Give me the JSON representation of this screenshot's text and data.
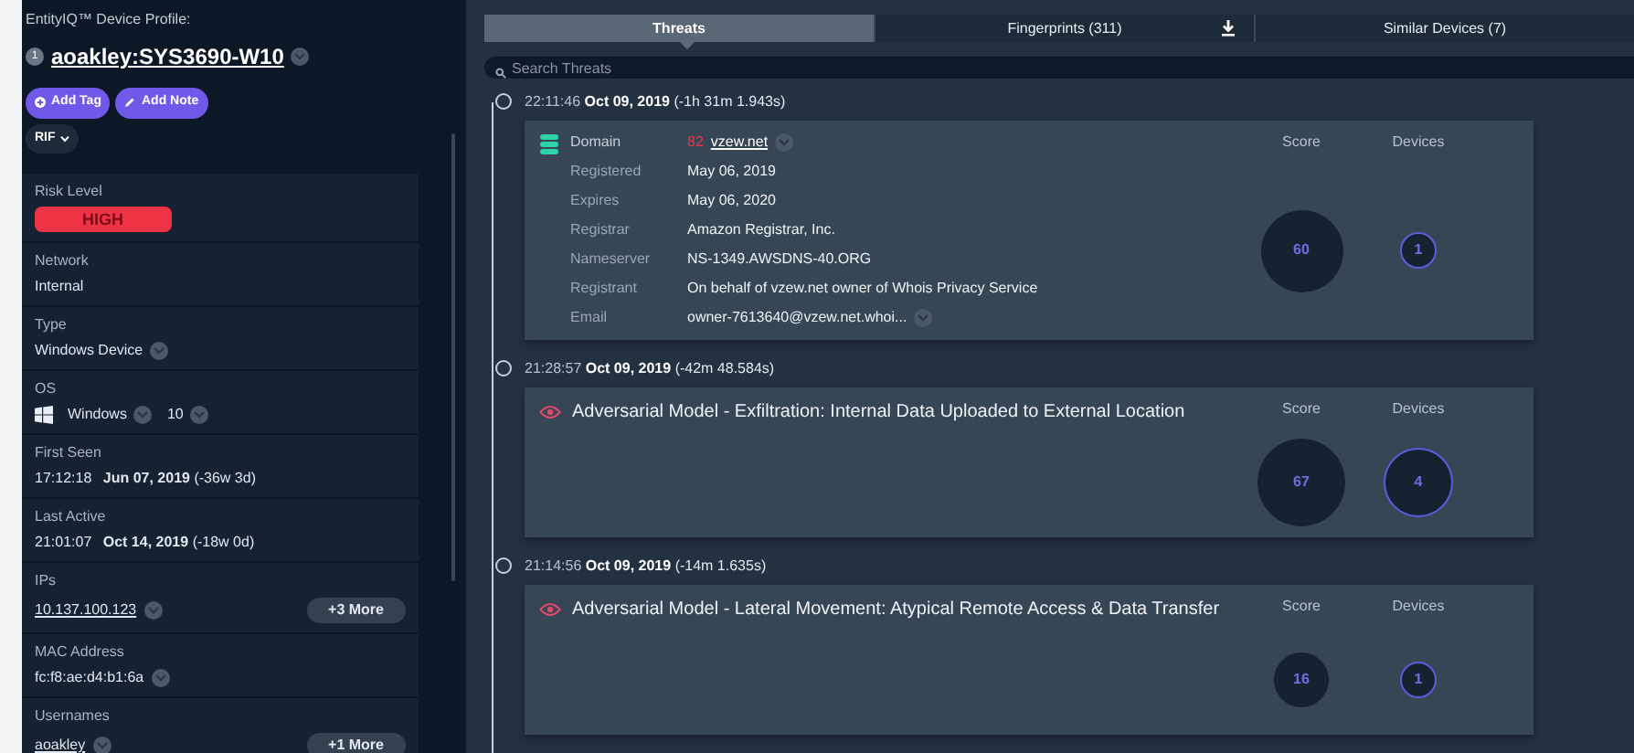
{
  "header": {
    "caption": "EntityIQ™ Device Profile:",
    "badge": "1",
    "device_name": "aoakley:SYS3690-W10"
  },
  "actions": [
    {
      "kind": "tag",
      "label": "Add Tag"
    },
    {
      "kind": "note",
      "label": "Add Note"
    }
  ],
  "rif": {
    "label": "RIF"
  },
  "fields": [
    {
      "kind": "risk",
      "label": "Risk Level",
      "value": "HIGH"
    },
    {
      "kind": "text",
      "label": "Network",
      "value": "Internal"
    },
    {
      "kind": "text",
      "label": "Type",
      "value": "Windows Device",
      "menu": true
    },
    {
      "kind": "os",
      "label": "OS",
      "value": "Windows",
      "version": "10"
    },
    {
      "kind": "time",
      "label": "First Seen",
      "time": "17:12:18",
      "date": "Jun 07, 2019",
      "ago": "(-36w 3d)"
    },
    {
      "kind": "time",
      "label": "Last Active",
      "time": "21:01:07",
      "date": "Oct 14, 2019",
      "ago": "(-18w 0d)"
    },
    {
      "kind": "link",
      "label": "IPs",
      "value": "10.137.100.123",
      "more": "+3 More"
    },
    {
      "kind": "text",
      "label": "MAC Address",
      "value": "fc:f8:ae:d4:b1:6a",
      "menu": true
    },
    {
      "kind": "link",
      "label": "Usernames",
      "value": "aoakley",
      "more": "+1 More"
    }
  ],
  "tabs": [
    {
      "label": "Threats",
      "selected": true
    },
    {
      "label": "Fingerprints (311)",
      "selected": false,
      "download": true
    },
    {
      "label": "Similar Devices (7)",
      "selected": false
    }
  ],
  "search": {
    "placeholder": "Search Threats"
  },
  "threats": [
    {
      "kind": "domain",
      "time": "22:11:46",
      "date": "Oct 09, 2019",
      "ago": "(-1h 31m 1.943s)",
      "title": "Domain",
      "domain_score": "82",
      "domain": "vzew.net",
      "details": [
        {
          "label": "Registered",
          "value": "May 06, 2019"
        },
        {
          "label": "Expires",
          "value": "May 06, 2020"
        },
        {
          "label": "Registrar",
          "value": "Amazon Registrar, Inc."
        },
        {
          "label": "Nameserver",
          "value": "NS-1349.AWSDNS-40.ORG"
        },
        {
          "label": "Registrant",
          "value": "On behalf of vzew.net owner of Whois Privacy Service"
        },
        {
          "label": "Email",
          "value": "owner-7613640@vzew.net.whoi...",
          "menu": true
        }
      ],
      "score_label": "Score",
      "score": "60",
      "devices_label": "Devices",
      "devices": "1"
    },
    {
      "kind": "model",
      "time": "21:28:57",
      "date": "Oct 09, 2019",
      "ago": "(-42m 48.584s)",
      "title": "Adversarial Model - Exfiltration: Internal Data Uploaded to External Location",
      "score_label": "Score",
      "score": "67",
      "devices_label": "Devices",
      "devices": "4"
    },
    {
      "kind": "model",
      "time": "21:14:56",
      "date": "Oct 09, 2019",
      "ago": "(-14m 1.635s)",
      "title": "Adversarial Model - Lateral Movement: Atypical Remote Access & Data Transfer",
      "score_label": "Score",
      "score": "16",
      "devices_label": "Devices",
      "devices": "1"
    }
  ]
}
